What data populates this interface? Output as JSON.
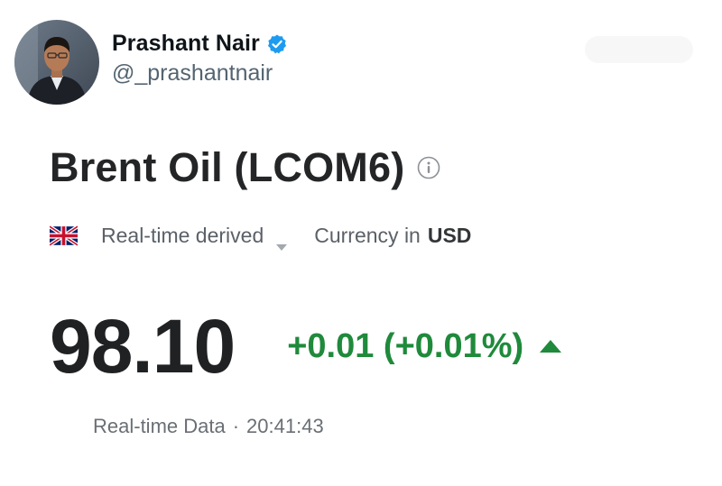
{
  "tweet": {
    "author_name": "Prashant Nair",
    "author_handle": "@_prashantnair",
    "verified": true
  },
  "quote": {
    "instrument": "Brent Oil (LCOM6)",
    "flag": "uk-flag-icon",
    "data_source": "Real-time derived",
    "currency_label": "Currency in",
    "currency": "USD",
    "last_price": "98.10",
    "change": "+0.01 (+0.01%)",
    "direction": "up",
    "data_label": "Real-time Data",
    "separator": "·",
    "time": "20:41:43"
  },
  "colors": {
    "positive": "#1f8a3b",
    "verified": "#1d9bf0",
    "text_primary": "#1f2123",
    "text_secondary": "#5b6168"
  }
}
